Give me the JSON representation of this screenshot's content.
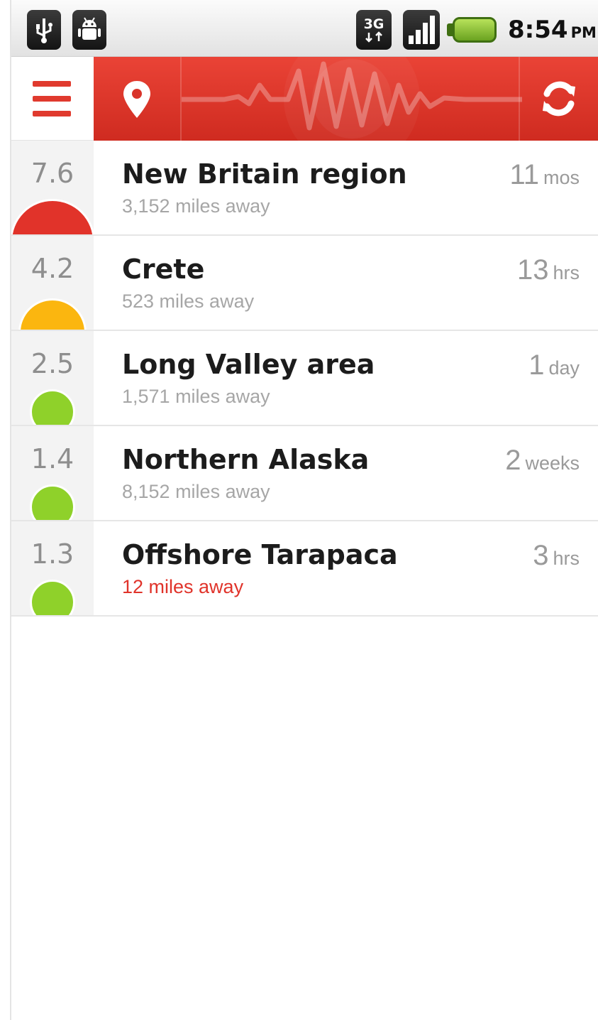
{
  "status_bar": {
    "left_icons": [
      "usb-icon",
      "android-debug-icon"
    ],
    "right_icons": [
      "network-3g-icon",
      "signal-icon",
      "battery-icon"
    ],
    "network_label": "3G",
    "time": "8:54",
    "ampm": "PM"
  },
  "action_bar": {
    "icons": [
      "menu-icon",
      "location-pin-icon",
      "seismograph-wave-icon",
      "refresh-icon"
    ],
    "accent_color": "#e03a2e"
  },
  "quakes": [
    {
      "magnitude": "7.6",
      "place": "New Britain region",
      "distance": "3,152 miles away",
      "ago_num": "11",
      "ago_unit": "mos",
      "color": "#e1332a",
      "size": "big",
      "near": false
    },
    {
      "magnitude": "4.2",
      "place": "Crete",
      "distance": "523 miles away",
      "ago_num": "13",
      "ago_unit": "hrs",
      "color": "#fbb60f",
      "size": "mid",
      "near": false
    },
    {
      "magnitude": "2.5",
      "place": "Long Valley area",
      "distance": "1,571 miles away",
      "ago_num": "1",
      "ago_unit": "day",
      "color": "#8fd12a",
      "size": "sm",
      "near": false
    },
    {
      "magnitude": "1.4",
      "place": "Northern Alaska",
      "distance": "8,152 miles away",
      "ago_num": "2",
      "ago_unit": "weeks",
      "color": "#8fd12a",
      "size": "sm",
      "near": false
    },
    {
      "magnitude": "1.3",
      "place": "Offshore Tarapaca",
      "distance": "12 miles away",
      "ago_num": "3",
      "ago_unit": "hrs",
      "color": "#8fd12a",
      "size": "sm",
      "near": true
    }
  ]
}
